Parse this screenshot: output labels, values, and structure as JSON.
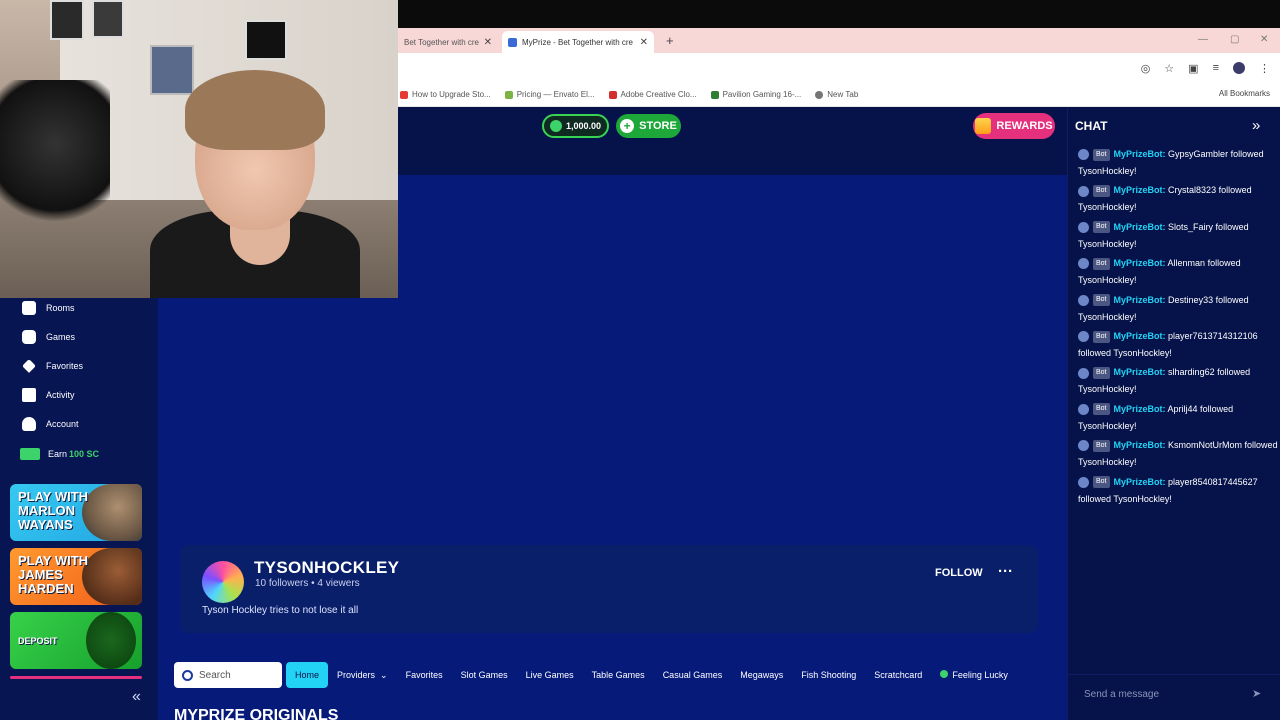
{
  "browser": {
    "tabs": [
      {
        "title": "Bet Together with cre"
      },
      {
        "title": "MyPrize - Bet Together with cre"
      }
    ],
    "new_tab": "+",
    "close": "✕",
    "bookmarks": [
      {
        "label": "How to Upgrade Sto...",
        "color": "#e53935"
      },
      {
        "label": "Pricing — Envato El...",
        "color": "#7cb342"
      },
      {
        "label": "Adobe Creative Clo...",
        "color": "#d32f2f"
      },
      {
        "label": "Pavilion Gaming 16-...",
        "color": "#2e7d32"
      },
      {
        "label": "New Tab",
        "color": "#757575"
      }
    ],
    "all_bookmarks": "All Bookmarks"
  },
  "header": {
    "balance": "1,000.00",
    "store_label": "STORE",
    "rewards_label": "REWARDS"
  },
  "nav": {
    "items": [
      {
        "label": "Rooms"
      },
      {
        "label": "Games"
      },
      {
        "label": "Favorites"
      },
      {
        "label": "Activity"
      },
      {
        "label": "Account"
      }
    ],
    "earn_label": "Earn",
    "earn_amount": "100 SC"
  },
  "promos": [
    {
      "text": "PLAY WITH MARLON WAYANS"
    },
    {
      "text": "PLAY WITH JAMES HARDEN"
    },
    {
      "text": "DEPOSIT"
    }
  ],
  "collapse_icon": "«",
  "profile": {
    "name": "TYSONHOCKLEY",
    "stats": "10 followers • 4 viewers",
    "description": "Tyson Hockley tries to not lose it all",
    "follow_label": "FOLLOW",
    "more": "···"
  },
  "categories": {
    "search_placeholder": "Search",
    "items": [
      "Home",
      "Providers",
      "Favorites",
      "Slot Games",
      "Live Games",
      "Table Games",
      "Casual Games",
      "Megaways",
      "Fish Shooting",
      "Scratchcard",
      "Feeling Lucky"
    ]
  },
  "section_title": "MYPRIZE ORIGINALS",
  "chat": {
    "title": "CHAT",
    "collapse": "»",
    "badge": "Bot",
    "messages": [
      {
        "user": "MyPrizeBot:",
        "text": "GypsyGambler followed TysonHockley!"
      },
      {
        "user": "MyPrizeBot:",
        "text": "Crystal8323 followed TysonHockley!"
      },
      {
        "user": "MyPrizeBot:",
        "text": "Slots_Fairy followed TysonHockley!"
      },
      {
        "user": "MyPrizeBot:",
        "text": "Allenman followed TysonHockley!"
      },
      {
        "user": "MyPrizeBot:",
        "text": "Destiney33 followed TysonHockley!"
      },
      {
        "user": "MyPrizeBot:",
        "text": "player7613714312106 followed TysonHockley!"
      },
      {
        "user": "MyPrizeBot:",
        "text": "slharding62 followed TysonHockley!"
      },
      {
        "user": "MyPrizeBot:",
        "text": "Aprilj44 followed TysonHockley!"
      },
      {
        "user": "MyPrizeBot:",
        "text": "KsmomNotUrMom followed TysonHockley!"
      },
      {
        "user": "MyPrizeBot:",
        "text": "player8540817445627 followed TysonHockley!"
      }
    ],
    "input_placeholder": "Send a message",
    "send_icon": "➤"
  }
}
